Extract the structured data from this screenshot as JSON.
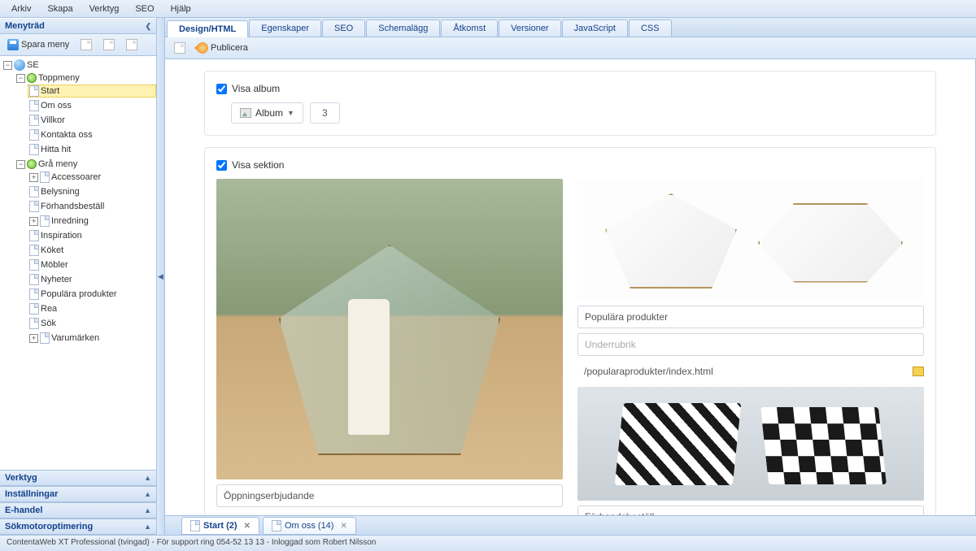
{
  "menubar": [
    "Arkiv",
    "Skapa",
    "Verktyg",
    "SEO",
    "Hjälp"
  ],
  "sidebar": {
    "title": "Menyträd",
    "save_label": "Spara meny",
    "tree": {
      "root": "SE",
      "topmenu": "Toppmeny",
      "top_items": [
        "Start",
        "Om oss",
        "Villkor",
        "Kontakta oss",
        "Hitta hit"
      ],
      "greymenu": "Grå meny",
      "grey_items": [
        "Accessoarer",
        "Belysning",
        "Förhandsbeställ",
        "Inredning",
        "Inspiration",
        "Köket",
        "Möbler",
        "Nyheter",
        "Populära produkter",
        "Rea",
        "Sök",
        "Varumärken"
      ]
    },
    "panels": [
      "Verktyg",
      "Inställningar",
      "E-handel",
      "Sökmotoroptimering"
    ]
  },
  "tabs": [
    "Design/HTML",
    "Egenskaper",
    "SEO",
    "Schemalägg",
    "Åtkomst",
    "Versioner",
    "JavaScript",
    "CSS"
  ],
  "publish_label": "Publicera",
  "album": {
    "show_label": "Visa album",
    "dropdown": "Album",
    "count": "3"
  },
  "section": {
    "show_label": "Visa sektion",
    "left_title": "Öppningserbjudande",
    "right_title": "Populära produkter",
    "right_sub_placeholder": "Underrubrik",
    "right_path": "/popularaprodukter/index.html",
    "right_bottom_title": "Förhandsbeställ"
  },
  "bottom_tabs": [
    {
      "label": "Start (2)"
    },
    {
      "label": "Om oss (14)"
    }
  ],
  "status": "ContentaWeb XT Professional (tvingad) - För support ring 054-52 13 13 - Inloggad som Robert Nilsson"
}
